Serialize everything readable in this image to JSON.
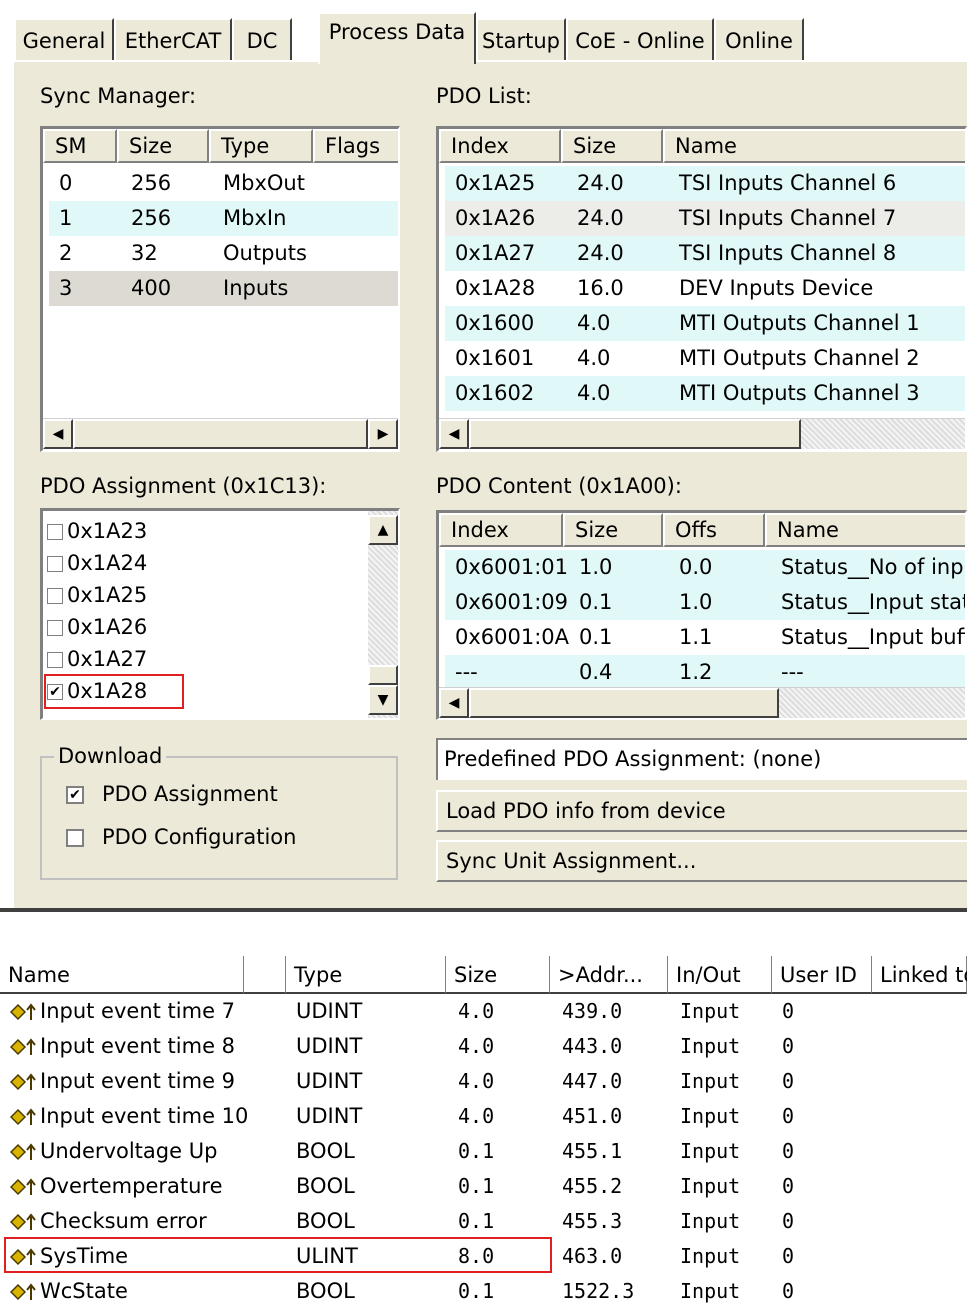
{
  "tabs": [
    "General",
    "EtherCAT",
    "DC",
    "Process Data",
    "Startup",
    "CoE - Online",
    "Online"
  ],
  "active_tab": "Process Data",
  "sync_manager": {
    "label": "Sync Manager:",
    "columns": [
      "SM",
      "Size",
      "Type",
      "Flags"
    ],
    "rows": [
      {
        "sm": "0",
        "size": "256",
        "type": "MbxOut",
        "flags": ""
      },
      {
        "sm": "1",
        "size": "256",
        "type": "MbxIn",
        "flags": ""
      },
      {
        "sm": "2",
        "size": "32",
        "type": "Outputs",
        "flags": ""
      },
      {
        "sm": "3",
        "size": "400",
        "type": "Inputs",
        "flags": ""
      }
    ]
  },
  "pdo_list": {
    "label": "PDO List:",
    "columns": [
      "Index",
      "Size",
      "Name"
    ],
    "rows": [
      {
        "index": "0x1A25",
        "size": "24.0",
        "name": "TSI Inputs Channel 6"
      },
      {
        "index": "0x1A26",
        "size": "24.0",
        "name": "TSI Inputs Channel 7"
      },
      {
        "index": "0x1A27",
        "size": "24.0",
        "name": "TSI Inputs Channel 8"
      },
      {
        "index": "0x1A28",
        "size": "16.0",
        "name": "DEV Inputs Device"
      },
      {
        "index": "0x1600",
        "size": "4.0",
        "name": "MTI Outputs Channel 1"
      },
      {
        "index": "0x1601",
        "size": "4.0",
        "name": "MTI Outputs Channel 2"
      },
      {
        "index": "0x1602",
        "size": "4.0",
        "name": "MTI Outputs Channel 3"
      }
    ]
  },
  "pdo_assignment": {
    "label": "PDO Assignment (0x1C13):",
    "items": [
      {
        "label": "0x1A23",
        "checked": false
      },
      {
        "label": "0x1A24",
        "checked": false
      },
      {
        "label": "0x1A25",
        "checked": false
      },
      {
        "label": "0x1A26",
        "checked": false
      },
      {
        "label": "0x1A27",
        "checked": false
      },
      {
        "label": "0x1A28",
        "checked": true
      }
    ]
  },
  "pdo_content": {
    "label": "PDO Content (0x1A00):",
    "columns": [
      "Index",
      "Size",
      "Offs",
      "Name"
    ],
    "rows": [
      {
        "index": "0x6001:01",
        "size": "1.0",
        "offs": "0.0",
        "name": "Status__No of input"
      },
      {
        "index": "0x6001:09",
        "size": "0.1",
        "offs": "1.0",
        "name": "Status__Input state"
      },
      {
        "index": "0x6001:0A",
        "size": "0.1",
        "offs": "1.1",
        "name": "Status__Input buffe"
      },
      {
        "index": "---",
        "size": "0.4",
        "offs": "1.2",
        "name": "---"
      }
    ]
  },
  "download": {
    "label": "Download",
    "pdo_assignment": {
      "label": "PDO Assignment",
      "checked": true
    },
    "pdo_configuration": {
      "label": "PDO Configuration",
      "checked": false
    }
  },
  "predefined_label": "Predefined PDO Assignment: (none)",
  "load_pdo_button": "Load PDO info from device",
  "sync_unit_button": "Sync Unit Assignment...",
  "variables": {
    "columns": [
      "Name",
      "",
      "Type",
      "Size",
      ">Addr...",
      "In/Out",
      "User ID",
      "Linked to"
    ],
    "rows": [
      {
        "name": "Input event time 7",
        "type": "UDINT",
        "size": "4.0",
        "addr": "439.0",
        "inout": "Input",
        "userid": "0"
      },
      {
        "name": "Input event time 8",
        "type": "UDINT",
        "size": "4.0",
        "addr": "443.0",
        "inout": "Input",
        "userid": "0"
      },
      {
        "name": "Input event time 9",
        "type": "UDINT",
        "size": "4.0",
        "addr": "447.0",
        "inout": "Input",
        "userid": "0"
      },
      {
        "name": "Input event time 10",
        "type": "UDINT",
        "size": "4.0",
        "addr": "451.0",
        "inout": "Input",
        "userid": "0"
      },
      {
        "name": "Undervoltage Up",
        "type": "BOOL",
        "size": "0.1",
        "addr": "455.1",
        "inout": "Input",
        "userid": "0"
      },
      {
        "name": "Overtemperature",
        "type": "BOOL",
        "size": "0.1",
        "addr": "455.2",
        "inout": "Input",
        "userid": "0"
      },
      {
        "name": "Checksum error",
        "type": "BOOL",
        "size": "0.1",
        "addr": "455.3",
        "inout": "Input",
        "userid": "0"
      },
      {
        "name": "SysTime",
        "type": "ULINT",
        "size": "8.0",
        "addr": "463.0",
        "inout": "Input",
        "userid": "0"
      },
      {
        "name": "WcState",
        "type": "BOOL",
        "size": "0.1",
        "addr": "1522.3",
        "inout": "Input",
        "userid": "0"
      }
    ]
  },
  "colors": {
    "highlight_row": "#e0f8f8",
    "selected_row": "#dcdad2",
    "panel_bg": "#ece9d8",
    "annotation_red": "#e02020",
    "icon_yellow": "#d8b400"
  }
}
